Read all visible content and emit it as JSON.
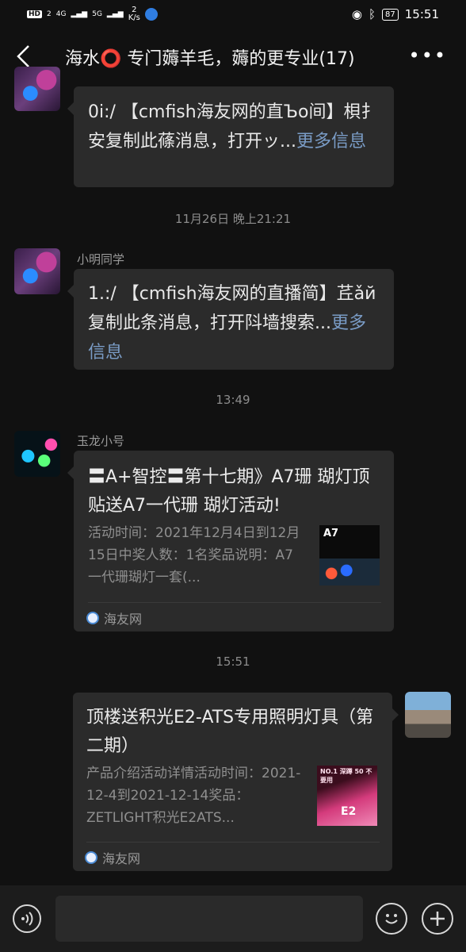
{
  "status_bar": {
    "left_badges": [
      "HD",
      "2",
      "4G",
      "5G"
    ],
    "speed_value": "2",
    "speed_unit": "K/s",
    "battery": "87",
    "time": "15:51"
  },
  "header": {
    "title": "海水⭕ 专门薅羊毛，薅的更专业(17)"
  },
  "messages": [
    {
      "text": "0i:/ 【cmfish海友网的直Ъo间】梖扌 安复制此蓧消息，打开ッ...",
      "more": "更多信息"
    },
    {
      "time": "11月26日 晚上21:21",
      "sender": "小明同学",
      "text": "1.:/ 【cmfish海友网的直播简】茊ǎй复制此条消息，打开阧墙搜索...",
      "more": "更多信息"
    },
    {
      "time": "13:49",
      "sender": "玉龙小号",
      "card_title": "〓A+智控〓第十七期》A7珊 瑚灯顶贴送A7一代珊 瑚灯活动!",
      "card_desc": "活动时间：2021年12月4日到12月15日中奖人数：1名奖品说明：A7一代珊瑚灯一套(...",
      "thumb_label": "A7",
      "source": "海友网"
    },
    {
      "time": "15:51",
      "card_title": "顶楼送积光E2-ATS专用照明灯具（第二期）",
      "card_desc": "产品介绍活动详情活动时间：2021-12-4到2021-12-14奖品：ZETLIGHT积光E2ATS...",
      "thumb_label": "E2",
      "thumb_banner": "NO.1 深蹲 50 不要用",
      "source": "海友网"
    }
  ]
}
